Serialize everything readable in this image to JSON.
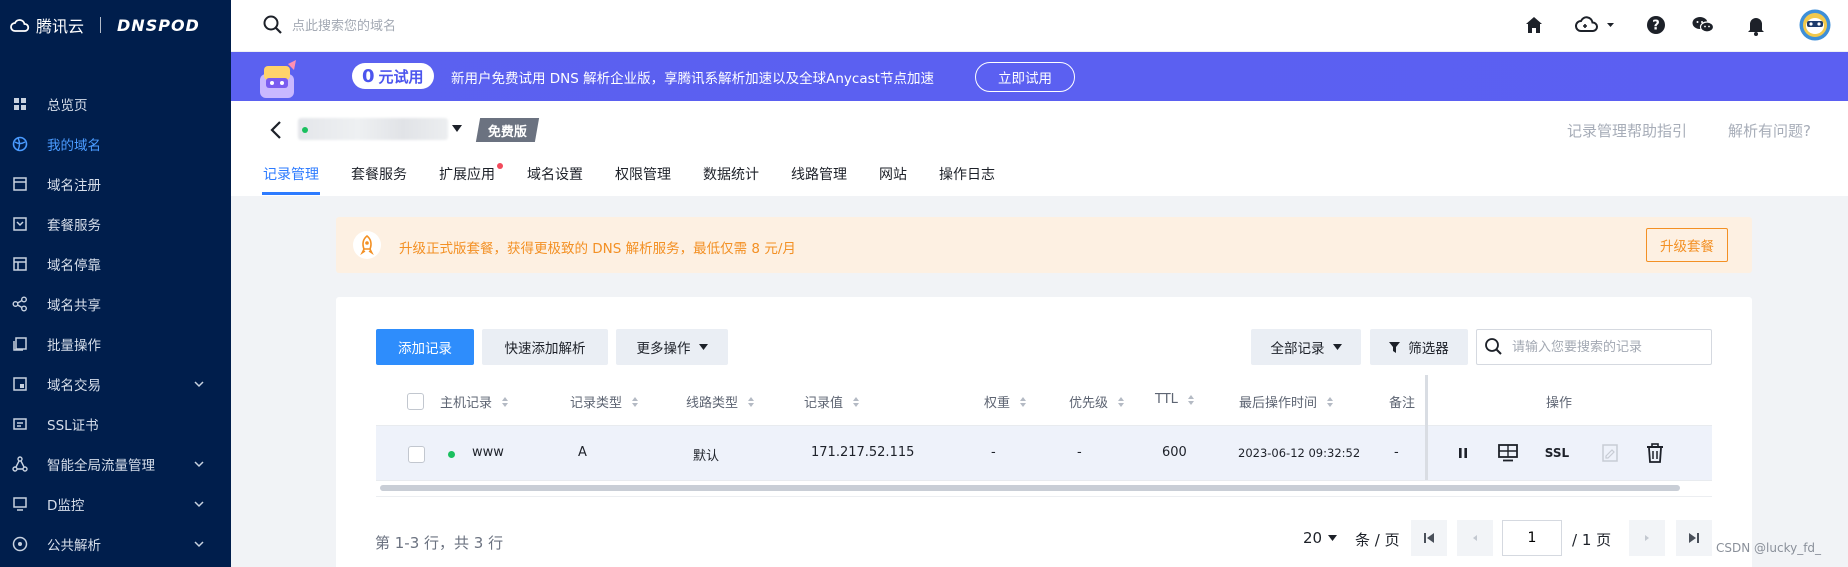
{
  "sidebar": {
    "brand_cn": "腾讯云",
    "brand_en": "DNSPOD",
    "items": [
      {
        "label": "总览页"
      },
      {
        "label": "我的域名"
      },
      {
        "label": "域名注册"
      },
      {
        "label": "套餐服务"
      },
      {
        "label": "域名停靠"
      },
      {
        "label": "域名共享"
      },
      {
        "label": "批量操作"
      },
      {
        "label": "域名交易"
      },
      {
        "label": "SSL证书"
      },
      {
        "label": "智能全局流量管理"
      },
      {
        "label": "D监控"
      },
      {
        "label": "公共解析"
      }
    ],
    "active_index": 1,
    "accent": "#4a9bff"
  },
  "topbar": {
    "search_placeholder": "点此搜索您的域名"
  },
  "promo": {
    "badge_num": "0",
    "badge_text": "元试用",
    "text": "新用户免费试用 DNS 解析企业版，享腾讯系解析加速以及全球Anycast节点加速",
    "button": "立即试用",
    "color": "#5b61f0"
  },
  "domain": {
    "edition": "免费版",
    "help_link": "记录管理帮助指引",
    "problem_link": "解析有问题?"
  },
  "tabs": [
    {
      "label": "记录管理"
    },
    {
      "label": "套餐服务"
    },
    {
      "label": "扩展应用"
    },
    {
      "label": "域名设置"
    },
    {
      "label": "权限管理"
    },
    {
      "label": "数据统计"
    },
    {
      "label": "线路管理"
    },
    {
      "label": "网站"
    },
    {
      "label": "操作日志"
    }
  ],
  "notice": {
    "text": "升级正式版套餐，获得更极致的 DNS 解析服务，最低仅需 8 元/月",
    "button": "升级套餐",
    "color": "#f39024"
  },
  "toolbar": {
    "add": "添加记录",
    "quick_add": "快速添加解析",
    "more": "更多操作",
    "all_records": "全部记录",
    "filter": "筛选器",
    "search_placeholder": "请输入您要搜索的记录"
  },
  "table": {
    "headers": {
      "host": "主机记录",
      "type": "记录类型",
      "line": "线路类型",
      "value": "记录值",
      "weight": "权重",
      "priority": "优先级",
      "ttl": "TTL",
      "time": "最后操作时间",
      "remark": "备注",
      "ops": "操作"
    },
    "rows": [
      {
        "host": "www",
        "type": "A",
        "line": "默认",
        "value": "171.217.52.115",
        "weight": "-",
        "priority": "-",
        "ttl": "600",
        "time": "2023-06-12 09:32:52",
        "remark": "-",
        "ssl": "SSL"
      }
    ]
  },
  "pagination": {
    "range": "第 1-3 行，共 3 行",
    "page_size": "20",
    "per_page": "条 / 页",
    "current": "1",
    "total": "/ 1 页"
  },
  "watermark": "CSDN @lucky_fd_"
}
